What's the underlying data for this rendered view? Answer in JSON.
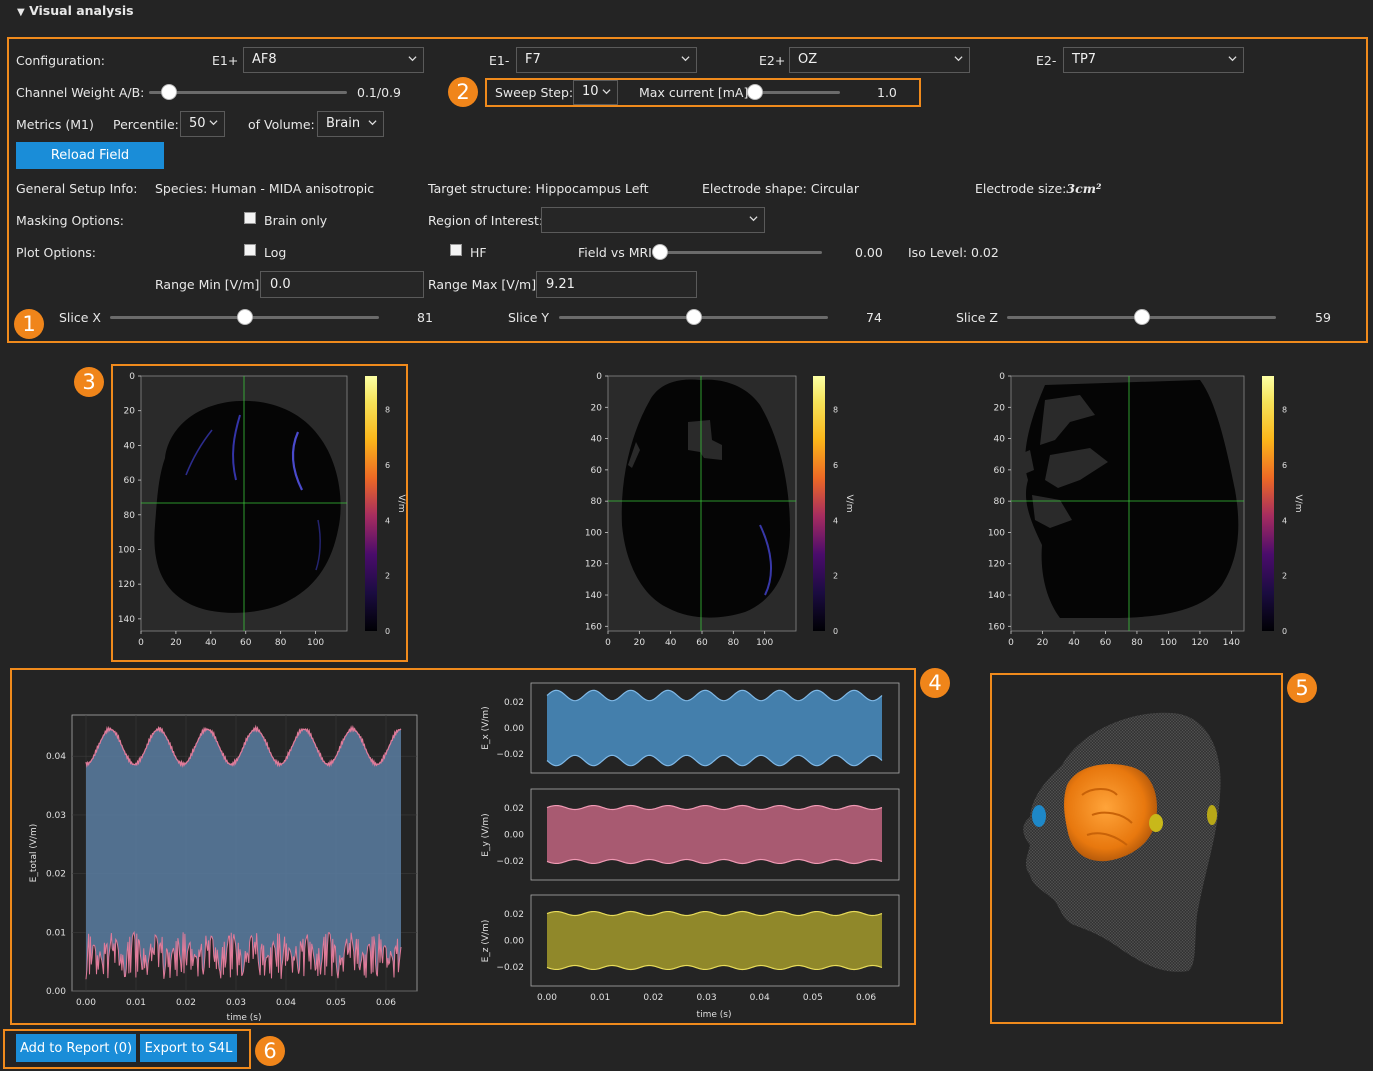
{
  "section": {
    "title": "Visual analysis"
  },
  "config": {
    "label": "Configuration:",
    "e1p": {
      "label": "E1+",
      "value": "AF8"
    },
    "e1m": {
      "label": "E1-",
      "value": "F7"
    },
    "e2p": {
      "label": "E2+",
      "value": "OZ"
    },
    "e2m": {
      "label": "E2-",
      "value": "TP7"
    }
  },
  "channel_weight": {
    "label": "Channel Weight A/B:",
    "value_text": "0.1/0.9",
    "level": 0.1
  },
  "sweep": {
    "label": "Sweep Step:",
    "value": "10",
    "max_label": "Max current [mA]:",
    "max_value": "1.0",
    "max_level": 0.0
  },
  "metrics": {
    "label": "Metrics (M1)",
    "percentile_label": "Percentile:",
    "percentile_value": "50",
    "volume_label": "of Volume:",
    "volume_value": "Brain"
  },
  "reload_button": "Reload Field",
  "setup": {
    "label": "General Setup Info:",
    "species": "Species: Human - MIDA anisotropic",
    "target": "Target structure: Hippocampus Left",
    "shape": "Electrode shape: Circular",
    "size_label": "Electrode size:",
    "size_value": "3cm²"
  },
  "masking": {
    "label": "Masking Options:",
    "brain_only": "Brain only",
    "roi_label": "Region of Interest:",
    "roi_value": ""
  },
  "plot_options": {
    "label": "Plot Options:",
    "log": "Log",
    "hf": "HF",
    "field_vs_mri": "Field vs MRI",
    "field_vs_mri_value": "0.00",
    "field_vs_mri_level": 0.0,
    "iso_level": "Iso Level: 0.02"
  },
  "range": {
    "min_label": "Range Min [V/m]",
    "min_value": "0.0",
    "max_label": "Range Max [V/m]",
    "max_value": "9.21"
  },
  "slices": {
    "x": {
      "label": "Slice X",
      "value": "81",
      "level": 0.5
    },
    "y": {
      "label": "Slice Y",
      "value": "74",
      "level": 0.5
    },
    "z": {
      "label": "Slice Z",
      "value": "59",
      "level": 0.5
    }
  },
  "badges": [
    "1",
    "2",
    "3",
    "4",
    "5",
    "6"
  ],
  "colorbar": {
    "label": "V/m",
    "ticks": [
      "0",
      "2",
      "4",
      "6",
      "8"
    ]
  },
  "slice_plots": [
    {
      "yticks": [
        "0",
        "20",
        "40",
        "60",
        "80",
        "100",
        "120",
        "140"
      ],
      "xticks": [
        "0",
        "20",
        "40",
        "60",
        "80",
        "100"
      ]
    },
    {
      "yticks": [
        "0",
        "20",
        "40",
        "60",
        "80",
        "100",
        "120",
        "140",
        "160"
      ],
      "xticks": [
        "0",
        "20",
        "40",
        "60",
        "80",
        "100"
      ]
    },
    {
      "yticks": [
        "0",
        "20",
        "40",
        "60",
        "80",
        "100",
        "120",
        "140",
        "160"
      ],
      "xticks": [
        "0",
        "20",
        "40",
        "60",
        "80",
        "100",
        "120",
        "140"
      ]
    }
  ],
  "chart_data": [
    {
      "type": "line",
      "title": "",
      "xlabel": "time (s)",
      "ylabel": "E_total (V/m)",
      "xlim": [
        0,
        0.063
      ],
      "ylim": [
        0,
        0.046
      ],
      "xticks": [
        "0.00",
        "0.01",
        "0.02",
        "0.03",
        "0.04",
        "0.05",
        "0.06"
      ],
      "yticks": [
        "0.00",
        "0.01",
        "0.02",
        "0.03",
        "0.04"
      ],
      "series": [
        {
          "color": "#e07b9a",
          "envelope_upper_min": 0.039,
          "envelope_upper_max": 0.045,
          "envelope_lower_min": 0.002,
          "envelope_lower_max": 0.01,
          "beats": 6.5
        }
      ]
    },
    {
      "type": "line",
      "ylabel": "E_x (V/m)",
      "yticks": [
        "0.02",
        "0.00",
        "−0.02"
      ],
      "series": [
        {
          "color": "#4a8fc4",
          "amplitude_min": 0.021,
          "amplitude_max": 0.029,
          "beats": 9
        }
      ]
    },
    {
      "type": "line",
      "ylabel": "E_y (V/m)",
      "yticks": [
        "0.02",
        "0.00",
        "−0.02"
      ],
      "series": [
        {
          "color": "#e07b9a",
          "amplitude_min": 0.019,
          "amplitude_max": 0.022,
          "beats": 9
        }
      ]
    },
    {
      "type": "line",
      "xlabel": "time (s)",
      "ylabel": "E_z (V/m)",
      "xticks": [
        "0.00",
        "0.01",
        "0.02",
        "0.03",
        "0.04",
        "0.05",
        "0.06"
      ],
      "yticks": [
        "0.02",
        "0.00",
        "−0.02"
      ],
      "series": [
        {
          "color": "#d4c43c",
          "amplitude_min": 0.019,
          "amplitude_max": 0.022,
          "beats": 9
        }
      ]
    }
  ],
  "footer": {
    "add_report": "Add to Report (0)",
    "export": "Export to S4L"
  },
  "colors": {
    "accent": "#f08a1c",
    "button": "#1a8dd8",
    "background": "#242424"
  }
}
